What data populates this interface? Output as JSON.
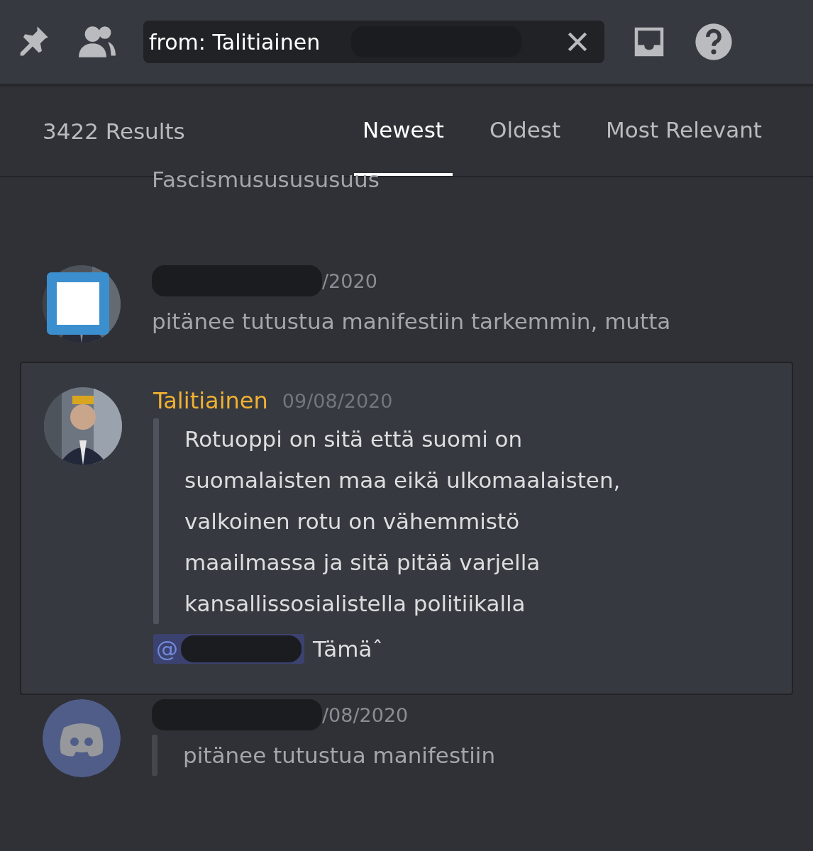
{
  "toolbar": {
    "search": {
      "value": "from: Talitiainen"
    }
  },
  "results": {
    "count": "3422 Results",
    "sort_tabs": [
      {
        "label": "Newest",
        "selected": true
      },
      {
        "label": "Oldest",
        "selected": false
      },
      {
        "label": "Most Relevant",
        "selected": false
      }
    ]
  },
  "messages": [
    {
      "kind": "faded",
      "text": "Fascismususususuus"
    },
    {
      "kind": "faded",
      "author_redacted": true,
      "date": "/2020",
      "text": "pitänee tutustua manifestiin tarkemmin, mutta",
      "overlay": true
    },
    {
      "kind": "highlighted",
      "author": "Talitiainen",
      "date": "09/08/2020",
      "text": "Rotuoppi on sitä että suomi on suomalaisten maa eikä ulkomaalaisten, valkoinen rotu on vähemmistö maailmassa ja sitä pitää varjella kansallissosialistella politiikalla",
      "quote": true,
      "mention": "@",
      "reply": "Tämäˆ"
    },
    {
      "kind": "faded",
      "avatar": {
        "kind": "default"
      },
      "author_redacted": true,
      "date": "/08/2020",
      "text": "pitänee tutustua manifestiin",
      "quote": true
    }
  ]
}
